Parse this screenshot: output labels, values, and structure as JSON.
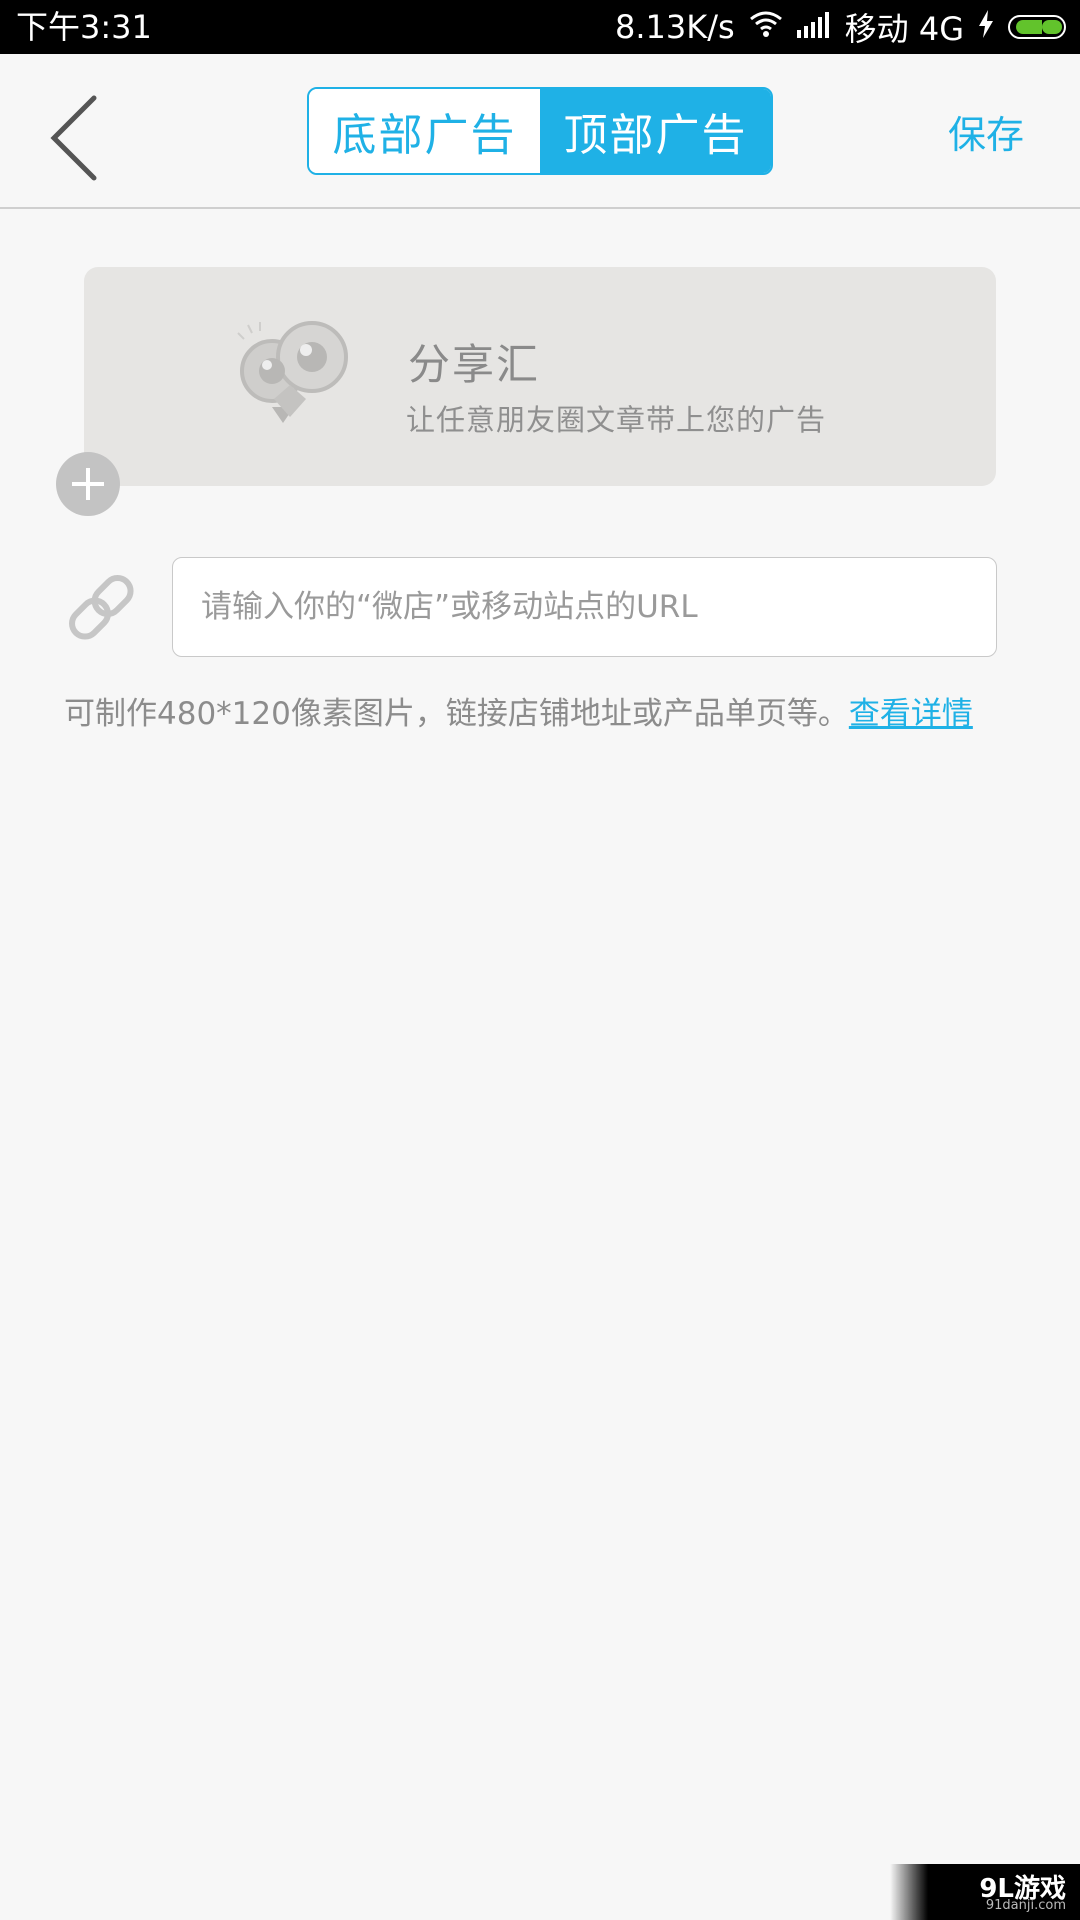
{
  "status_bar": {
    "time": "下午3:31",
    "net_speed": "8.13K/s",
    "carrier": "移动 4G",
    "battery_color": "#62c32c"
  },
  "navbar": {
    "tabs": [
      {
        "label": "底部广告",
        "active": false
      },
      {
        "label": "顶部广告",
        "active": true
      }
    ],
    "save_label": "保存",
    "accent_color": "#1fb1e6"
  },
  "banner": {
    "title": "分享汇",
    "subtitle": "让任意朋友圈文章带上您的广告"
  },
  "url_field": {
    "placeholder": "请输入你的“微店”或移动站点的URL",
    "value": ""
  },
  "hint": {
    "text": "可制作480*120像素图片，链接店铺地址或产品单页等。",
    "link_label": "查看详情"
  },
  "watermark": {
    "text": "9L游戏",
    "sub": "91danji.com"
  },
  "icons": [
    "back-arrow-icon",
    "add-image-icon",
    "link-icon",
    "wifi-icon",
    "signal-icon",
    "charging-icon",
    "battery-icon"
  ]
}
